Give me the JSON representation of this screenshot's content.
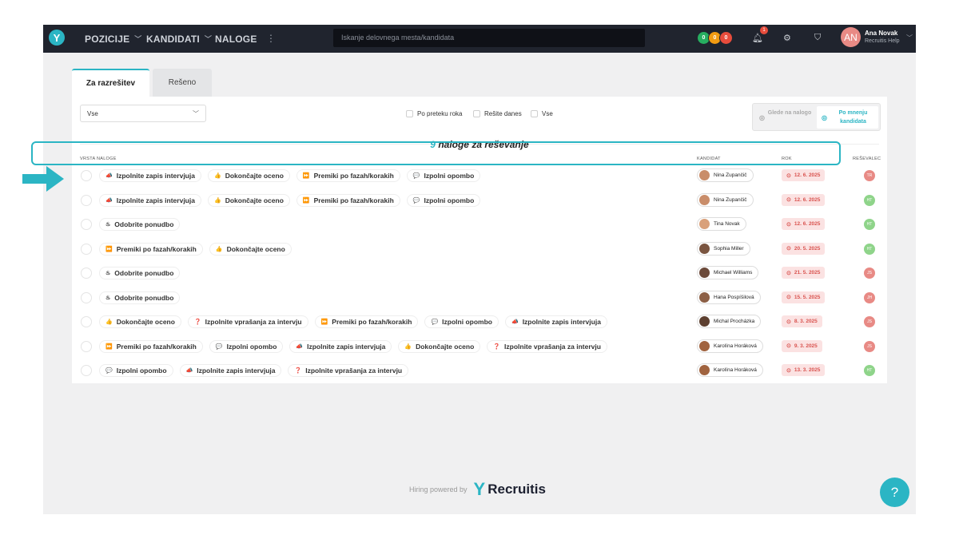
{
  "nav": {
    "items": [
      {
        "label": "POZICIJE"
      },
      {
        "label": "KANDIDATI"
      },
      {
        "label": "NALOGE"
      }
    ],
    "search_placeholder": "Iskanje delovnega mesta/kandidata",
    "counters": [
      "0",
      "0",
      "0"
    ],
    "notifications_badge": "1",
    "user": {
      "initials": "AN",
      "name": "Ana Novak",
      "subtitle": "Recruitis Help"
    }
  },
  "tabs": {
    "active": "Za razrešitev",
    "inactive": "Rešeno"
  },
  "filters": {
    "select_value": "Vse",
    "checkboxes": [
      "Po preteku roka",
      "Rešite danes",
      "Vse"
    ],
    "toggle": [
      "Glede na nalogo",
      "Po mnenju kandidata"
    ]
  },
  "heading": {
    "count": "9",
    "text": "naloge za reševanje"
  },
  "columns": {
    "type": "VRSTA NALOGE",
    "candidate": "KANDIDAT",
    "deadline": "ROK",
    "resolver": "REŠEVALEC"
  },
  "rows": [
    {
      "tags": [
        {
          "icon": "📣",
          "label": "Izpolnite zapis intervjuja"
        },
        {
          "icon": "👍",
          "label": "Dokončajte oceno"
        },
        {
          "icon": "⏩",
          "label": "Premiki po fazah/korakih"
        },
        {
          "icon": "💬",
          "label": "Izpolni opombo"
        }
      ],
      "candidate": "Nina Zupančič",
      "deadline": "12. 6. 2025",
      "resolver": "TR",
      "resolver_color": "#e88a85"
    },
    {
      "tags": [
        {
          "icon": "📣",
          "label": "Izpolnite zapis intervjuja"
        },
        {
          "icon": "👍",
          "label": "Dokončajte oceno"
        },
        {
          "icon": "⏩",
          "label": "Premiki po fazah/korakih"
        },
        {
          "icon": "💬",
          "label": "Izpolni opombo"
        }
      ],
      "candidate": "Nina Zupančič",
      "deadline": "12. 6. 2025",
      "resolver": "HT",
      "resolver_color": "#8fd48a"
    },
    {
      "tags": [
        {
          "icon": "♨",
          "label": "Odobrite ponudbo"
        }
      ],
      "candidate": "Tina Novak",
      "deadline": "12. 6. 2025",
      "resolver": "HT",
      "resolver_color": "#8fd48a"
    },
    {
      "tags": [
        {
          "icon": "⏩",
          "label": "Premiki po fazah/korakih"
        },
        {
          "icon": "👍",
          "label": "Dokončajte oceno"
        }
      ],
      "candidate": "Sophia Miller",
      "deadline": "20. 5. 2025",
      "resolver": "HT",
      "resolver_color": "#8fd48a"
    },
    {
      "tags": [
        {
          "icon": "♨",
          "label": "Odobrite ponudbo"
        }
      ],
      "candidate": "Michael Williams",
      "deadline": "21. 5. 2025",
      "resolver": "JS",
      "resolver_color": "#e88a85"
    },
    {
      "tags": [
        {
          "icon": "♨",
          "label": "Odobrite ponudbo"
        }
      ],
      "candidate": "Hana Pospíšilová",
      "deadline": "15. 5. 2025",
      "resolver": "JH",
      "resolver_color": "#e88a85"
    },
    {
      "tags": [
        {
          "icon": "👍",
          "label": "Dokončajte oceno"
        },
        {
          "icon": "❓",
          "label": "Izpolnite vprašanja za intervju"
        },
        {
          "icon": "⏩",
          "label": "Premiki po fazah/korakih"
        },
        {
          "icon": "💬",
          "label": "Izpolni opombo"
        },
        {
          "icon": "📣",
          "label": "Izpolnite zapis intervjuja"
        }
      ],
      "candidate": "Michal Procházka",
      "deadline": "8. 3. 2025",
      "resolver": "JS",
      "resolver_color": "#e88a85"
    },
    {
      "tags": [
        {
          "icon": "⏩",
          "label": "Premiki po fazah/korakih"
        },
        {
          "icon": "💬",
          "label": "Izpolni opombo"
        },
        {
          "icon": "📣",
          "label": "Izpolnite zapis intervjuja"
        },
        {
          "icon": "👍",
          "label": "Dokončajte oceno"
        },
        {
          "icon": "❓",
          "label": "Izpolnite vprašanja za intervju"
        }
      ],
      "candidate": "Karolína Horáková",
      "deadline": "9. 3. 2025",
      "resolver": "JS",
      "resolver_color": "#e88a85"
    },
    {
      "tags": [
        {
          "icon": "💬",
          "label": "Izpolni opombo"
        },
        {
          "icon": "📣",
          "label": "Izpolnite zapis intervjuja"
        },
        {
          "icon": "❓",
          "label": "Izpolnite vprašanja za intervju"
        }
      ],
      "candidate": "Karolína Horáková",
      "deadline": "13. 3. 2025",
      "resolver": "HT",
      "resolver_color": "#8fd48a"
    }
  ],
  "footer": {
    "powered": "Hiring powered by",
    "brand": "Recruitis"
  },
  "help_label": "?"
}
